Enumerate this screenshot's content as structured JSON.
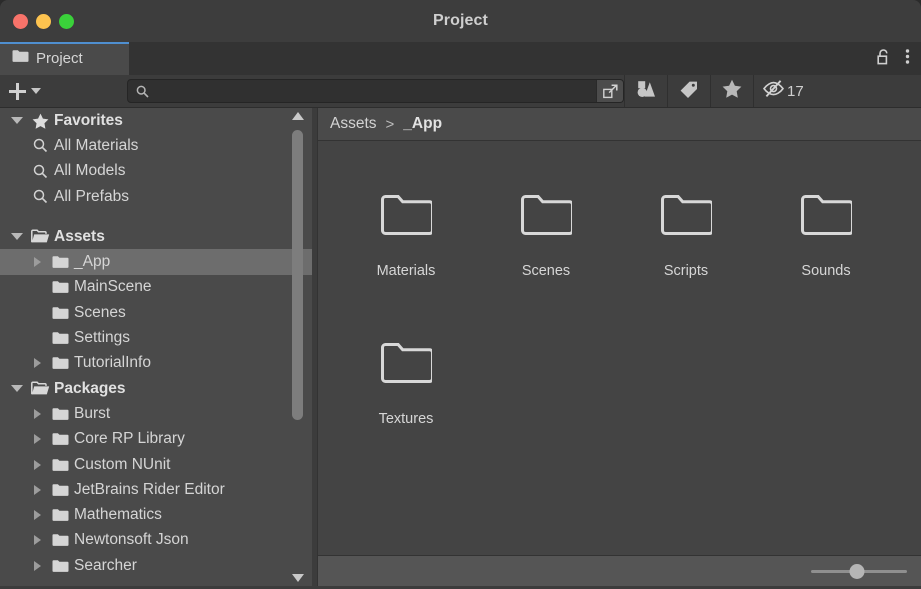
{
  "window": {
    "title": "Project",
    "traffic_lights": [
      "close",
      "minimize",
      "maximize"
    ]
  },
  "tabstrip": {
    "tabs": [
      {
        "label": "Project",
        "icon": "folder-icon",
        "active": true
      }
    ],
    "lock_icon": "lock-open-icon",
    "menu_icon": "kebab-menu-icon"
  },
  "toolbar": {
    "create_label": "+",
    "create_dropdown_icon": "chevron-down-icon",
    "search": {
      "placeholder": "",
      "value": "",
      "icon": "search-icon",
      "expand_icon": "expand-search-icon"
    },
    "filters": [
      {
        "name": "asset-type-filter",
        "icon": "shapes-icon"
      },
      {
        "name": "label-filter",
        "icon": "tag-icon"
      },
      {
        "name": "favorites-filter",
        "icon": "star-icon"
      }
    ],
    "hidden_assets": {
      "icon": "eye-slash-icon",
      "count": "17"
    }
  },
  "sidebar": {
    "groups": [
      {
        "label": "Favorites",
        "icon": "star-icon",
        "expanded": true,
        "items": [
          {
            "label": "All Materials",
            "icon": "search-icon"
          },
          {
            "label": "All Models",
            "icon": "search-icon"
          },
          {
            "label": "All Prefabs",
            "icon": "search-icon"
          }
        ]
      },
      {
        "label": "Assets",
        "icon": "open-folder-icon",
        "expanded": true,
        "items": [
          {
            "label": "_App",
            "icon": "folder-icon",
            "expandable": true,
            "selected": true
          },
          {
            "label": "MainScene",
            "icon": "folder-icon",
            "expandable": false,
            "selected": false
          },
          {
            "label": "Scenes",
            "icon": "folder-icon",
            "expandable": false,
            "selected": false
          },
          {
            "label": "Settings",
            "icon": "folder-icon",
            "expandable": false,
            "selected": false
          },
          {
            "label": "TutorialInfo",
            "icon": "folder-icon",
            "expandable": true,
            "selected": false
          }
        ]
      },
      {
        "label": "Packages",
        "icon": "open-folder-icon",
        "expanded": true,
        "items": [
          {
            "label": "Burst",
            "icon": "folder-icon",
            "expandable": true,
            "selected": false
          },
          {
            "label": "Core RP Library",
            "icon": "folder-icon",
            "expandable": true,
            "selected": false
          },
          {
            "label": "Custom NUnit",
            "icon": "folder-icon",
            "expandable": true,
            "selected": false
          },
          {
            "label": "JetBrains Rider Editor",
            "icon": "folder-icon",
            "expandable": true,
            "selected": false
          },
          {
            "label": "Mathematics",
            "icon": "folder-icon",
            "expandable": true,
            "selected": false
          },
          {
            "label": "Newtonsoft Json",
            "icon": "folder-icon",
            "expandable": true,
            "selected": false
          },
          {
            "label": "Searcher",
            "icon": "folder-icon",
            "expandable": true,
            "selected": false
          }
        ]
      }
    ],
    "scrollbar": {
      "up_icon": "scroll-up-arrow-icon",
      "down_icon": "scroll-down-arrow-icon"
    }
  },
  "content": {
    "breadcrumb": {
      "root": "Assets",
      "separator": ">",
      "current": "_App"
    },
    "items": [
      {
        "label": "Materials",
        "icon": "folder-outline-icon"
      },
      {
        "label": "Scenes",
        "icon": "folder-outline-icon"
      },
      {
        "label": "Scripts",
        "icon": "folder-outline-icon"
      },
      {
        "label": "Sounds",
        "icon": "folder-outline-icon"
      },
      {
        "label": "Textures",
        "icon": "folder-outline-icon"
      }
    ],
    "statusbar": {
      "zoom_slider": {
        "value": 48,
        "min": 0,
        "max": 100
      }
    }
  },
  "colors": {
    "accent": "#4f8fd0",
    "window_bg": "#3c3c3c",
    "sidebar_bg": "#4a4a4a",
    "content_bg": "#444444",
    "selected_row": "#6d6d6d",
    "statusbar_bg": "#555555",
    "traffic_close": "#f8736a",
    "traffic_minimize": "#fdc34f",
    "traffic_maximize": "#3ad13a"
  }
}
